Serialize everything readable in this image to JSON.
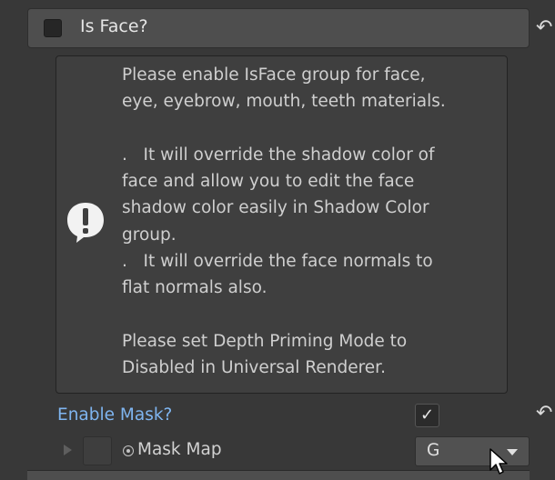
{
  "header": {
    "title": "Is Face?",
    "checked": false,
    "revert_icon": "revert-arrow-icon"
  },
  "help_box": {
    "icon": "info-speech-bubble-icon",
    "text": "Please enable IsFace group for face,\neye, eyebrow, mouth, teeth materials.\n\n.   It will override the shadow color of\nface and allow you to edit the face\nshadow color easily in Shadow Color\ngroup.\n.   It will override the face normals to\nflat normals also.\n\nPlease set Depth Priming Mode to\nDisabled in Universal Renderer."
  },
  "enable_mask": {
    "label": "Enable Mask?",
    "checked": true,
    "check_glyph": "✓",
    "revert_icon": "revert-arrow-icon"
  },
  "mask_map": {
    "label": "Mask Map",
    "picker_icon": "object-picker-icon",
    "channel_value": "G"
  },
  "colors": {
    "background": "#383838",
    "link_label": "#7fb5f0"
  }
}
